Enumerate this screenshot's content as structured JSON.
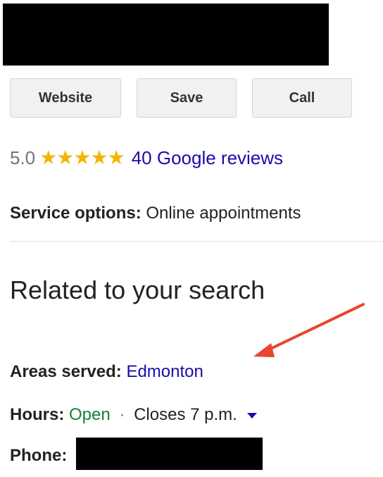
{
  "buttons": {
    "website": "Website",
    "save": "Save",
    "call": "Call"
  },
  "rating": {
    "value": "5.0",
    "stars_filled": 5,
    "stars_total": 5,
    "reviews_link": "40 Google reviews"
  },
  "service_options": {
    "label": "Service options:",
    "value": "Online appointments"
  },
  "related": {
    "heading": "Related to your search"
  },
  "areas_served": {
    "label": "Areas served:",
    "value": "Edmonton"
  },
  "hours": {
    "label": "Hours:",
    "status": "Open",
    "separator": "·",
    "closes": "Closes 7 p.m."
  },
  "phone": {
    "label": "Phone:"
  },
  "colors": {
    "link": "#1a0dab",
    "open": "#188038",
    "star": "#f4b400",
    "annotation_arrow": "#e8452c"
  }
}
